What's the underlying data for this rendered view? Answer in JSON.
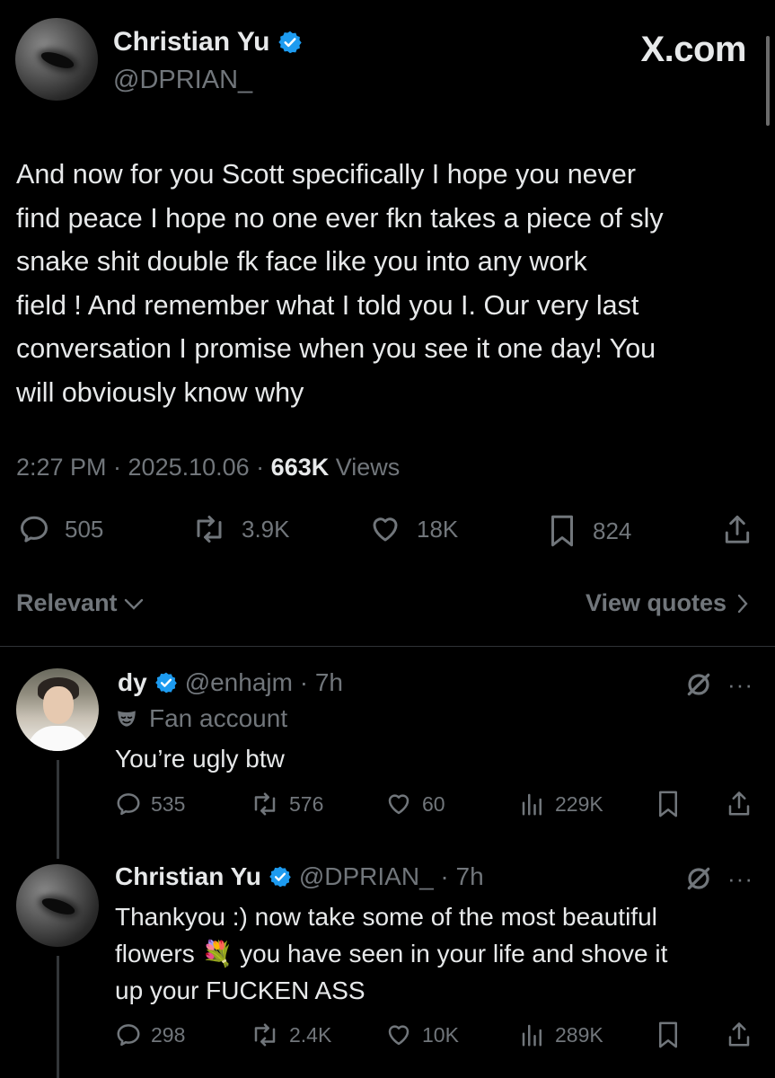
{
  "brand": "X.com",
  "main_tweet": {
    "display_name": "Christian Yu",
    "handle": "@DPRIAN_",
    "text": "And now for you Scott specifically I hope you never\nfind peace I hope no one ever fkn takes a piece of sly\nsnake shit double fk face like you into any work\nfield ! And remember what I told you I. Our very last\nconversation I promise when you see it one day! You\nwill obviously know why",
    "time": "2:27 PM · 2025.10.06 · ",
    "views_count": "663K",
    "views_label": " Views",
    "replies": "505",
    "reposts": "3.9K",
    "likes": "18K",
    "bookmarks": "824"
  },
  "sort": {
    "relevant_label": "Relevant",
    "view_quotes_label": "View quotes"
  },
  "replies": [
    {
      "display_name": "dy",
      "handle_time": "@enhajm · 7h",
      "label": "Fan account",
      "text": "You’re ugly btw",
      "replies": "535",
      "reposts": "576",
      "likes": "60",
      "views": "229K"
    },
    {
      "display_name": "Christian Yu",
      "handle_time": "@DPRIAN_ · 7h",
      "text": "Thankyou :) now take some of the most beautiful\nflowers 💐 you have seen in your life and shove it\nup your FUCKEN ASS",
      "replies": "298",
      "reposts": "2.4K",
      "likes": "10K",
      "views": "289K"
    }
  ],
  "colors": {
    "background": "#000000",
    "text": "#e7e9ea",
    "muted": "#71767b",
    "verified": "#1d9bf0"
  }
}
